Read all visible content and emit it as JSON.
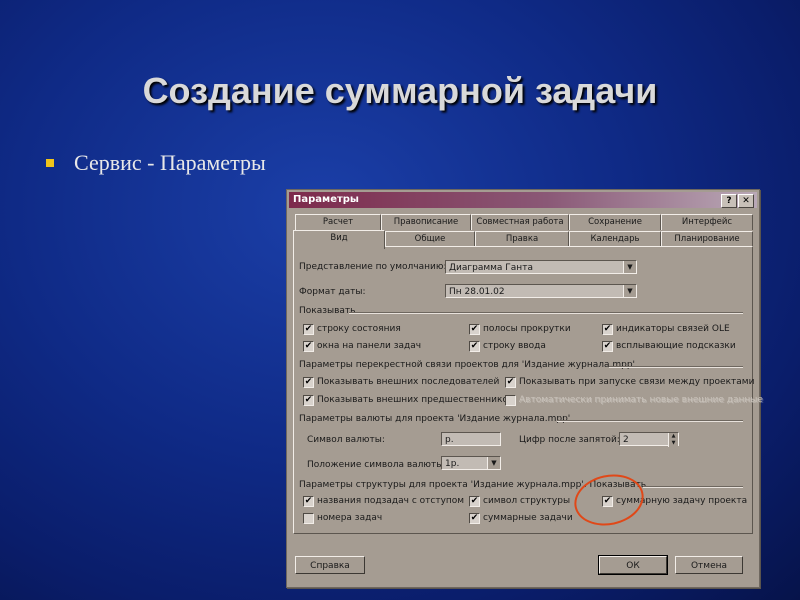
{
  "slide": {
    "title": "Создание суммарной задачи",
    "bullet": "Сервис - Параметры"
  },
  "dialog": {
    "title": "Параметры",
    "help_btn": "?",
    "close_btn": "✕",
    "tabs_back": [
      "Расчет",
      "Правописание",
      "Совместная работа",
      "Сохранение",
      "Интерфейс"
    ],
    "tabs_front": [
      "Вид",
      "Общие",
      "Правка",
      "Календарь",
      "Планирование"
    ],
    "default_view_label": "Представление по умолчанию:",
    "default_view_value": "Диаграмма Ганта",
    "date_format_label": "Формат даты:",
    "date_format_value": "Пн 28.01.02",
    "show_group": "Показывать",
    "show_items": [
      {
        "label": "строку состояния",
        "checked": "✔"
      },
      {
        "label": "полосы прокрутки",
        "checked": "✔"
      },
      {
        "label": "индикаторы связей OLE",
        "checked": "✔"
      },
      {
        "label": "окна на панели задач",
        "checked": "✔"
      },
      {
        "label": "строку ввода",
        "checked": "✔"
      },
      {
        "label": "всплывающие подсказки",
        "checked": "✔"
      }
    ],
    "cross_group": "Параметры перекрестной связи проектов для 'Издание журнала.mpp'",
    "cross_items": [
      {
        "label": "Показывать внешних последователей",
        "checked": "✔"
      },
      {
        "label": "Показывать при запуске связи между проектами",
        "checked": "✔"
      },
      {
        "label": "Показывать внешних предшественников",
        "checked": "✔"
      },
      {
        "label": "Автоматически принимать новые внешние данные",
        "checked": ""
      }
    ],
    "currency_group": "Параметры валюты для проекта 'Издание журнала.mpp'",
    "currency_symbol_label": "Символ валюты:",
    "currency_symbol_value": "р.",
    "decimal_digits_label": "Цифр после запятой:",
    "decimal_digits_value": "2",
    "symbol_position_label": "Положение символа валюты:",
    "symbol_position_value": "1р.",
    "outline_group": "Параметры структуры для проекта 'Издание журнала.mpp'. Показывать",
    "outline_items": [
      {
        "label": "названия подзадач с отступом",
        "checked": "✔"
      },
      {
        "label": "символ структуры",
        "checked": "✔"
      },
      {
        "label": "суммарную задачу проекта",
        "checked": "✔"
      },
      {
        "label": "номера задач",
        "checked": ""
      },
      {
        "label": "суммарные задачи",
        "checked": "✔"
      }
    ],
    "help_button": "Справка",
    "ok_button": "ОК",
    "cancel_button": "Отмена"
  },
  "colors": {
    "annotation_circle": "#e04818",
    "bullet": "#f0c419"
  }
}
